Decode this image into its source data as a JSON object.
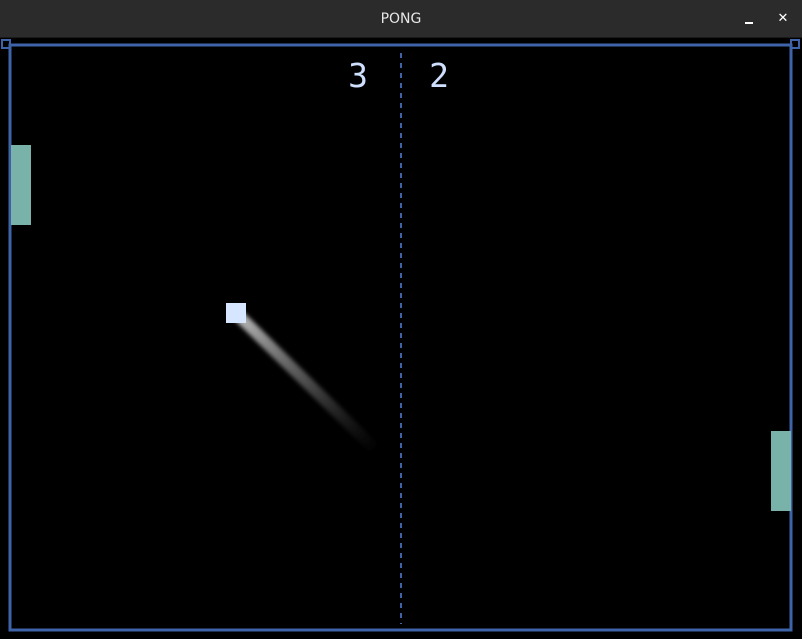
{
  "window": {
    "title": "PONG",
    "minimize_icon": "minimize-icon",
    "close_icon": "close-icon",
    "close_glyph": "✕"
  },
  "game": {
    "score_left": "3",
    "score_right": "2",
    "colors": {
      "border": "#3e63a8",
      "paddle": "#78b2a8",
      "ball": "#d6e6ff",
      "score": "#cfe0ff",
      "background": "#000000"
    }
  }
}
